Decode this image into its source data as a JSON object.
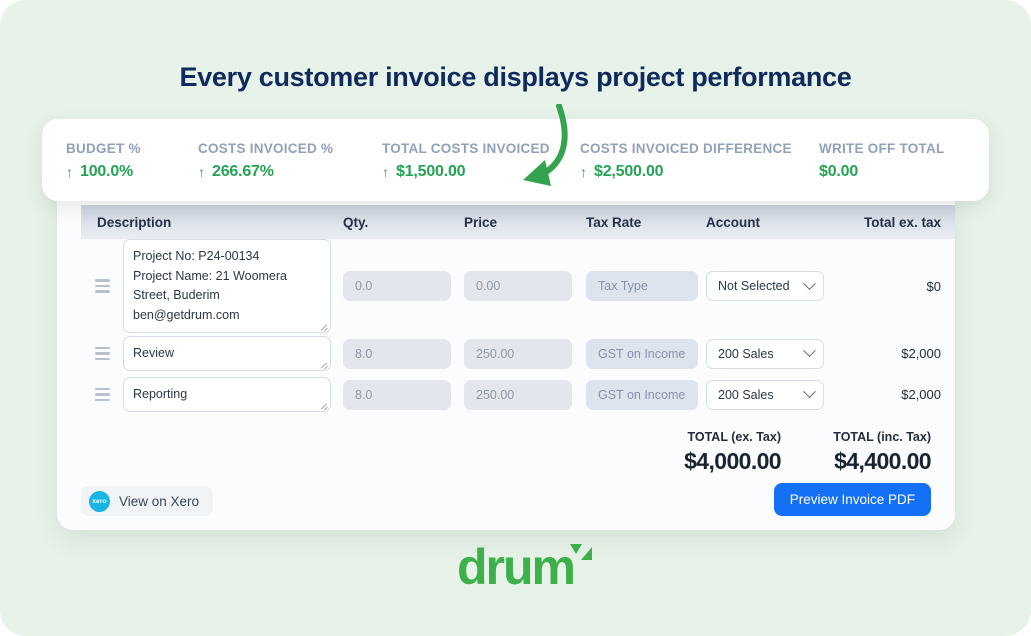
{
  "page": {
    "background_color": "#e7f2e9",
    "headline": "Every customer invoice displays project performance",
    "headline_color": "#112a5e"
  },
  "metrics": {
    "accent_color": "#23a455",
    "label_color": "#92a0b8",
    "items": [
      {
        "label": "BUDGET %",
        "value": "100.0%",
        "arrow": "↑",
        "has_arrow": true
      },
      {
        "label": "COSTS INVOICED %",
        "value": "266.67%",
        "arrow": "↑",
        "has_arrow": true
      },
      {
        "label": "TOTAL COSTS INVOICED",
        "value": "$1,500.00",
        "arrow": "↑",
        "has_arrow": true
      },
      {
        "label": "COSTS INVOICED DIFFERENCE",
        "value": "$2,500.00",
        "arrow": "↑",
        "has_arrow": true
      },
      {
        "label": "WRITE OFF TOTAL",
        "value": "$0.00",
        "arrow": "",
        "has_arrow": false
      }
    ]
  },
  "annotation": {
    "type": "curved-arrow",
    "color": "#33a44d",
    "points_to": "TOTAL COSTS INVOICED"
  },
  "invoice": {
    "columns": {
      "description": "Description",
      "qty": "Qty.",
      "price": "Price",
      "tax_rate": "Tax Rate",
      "account": "Account",
      "total_ex_tax": "Total ex. tax"
    },
    "rows": [
      {
        "description": "Project No: P24-00134\nProject Name: 21 Woomera Street, Buderim\nben@getdrum.com",
        "qty": "0.0",
        "price": "0.00",
        "tax_rate": "Tax Type",
        "account": "Not Selected",
        "total": "$0"
      },
      {
        "description": "Review",
        "qty": "8.0",
        "price": "250.00",
        "tax_rate": "GST on Income",
        "account": "200 Sales",
        "total": "$2,000"
      },
      {
        "description": "Reporting",
        "qty": "8.0",
        "price": "250.00",
        "tax_rate": "GST on Income",
        "account": "200 Sales",
        "total": "$2,000"
      }
    ],
    "totals": [
      {
        "label": "TOTAL (ex. Tax)",
        "amount": "$4,000.00"
      },
      {
        "label": "TOTAL (inc. Tax)",
        "amount": "$4,400.00"
      }
    ],
    "footer": {
      "xero_label": "View on Xero",
      "xero_logo_text": "xero",
      "xero_logo_color": "#1ab4e5",
      "preview_label": "Preview Invoice PDF",
      "preview_color": "#1471f5"
    }
  },
  "brand": {
    "logo_text": "drum",
    "logo_color": "#3eb04a"
  }
}
